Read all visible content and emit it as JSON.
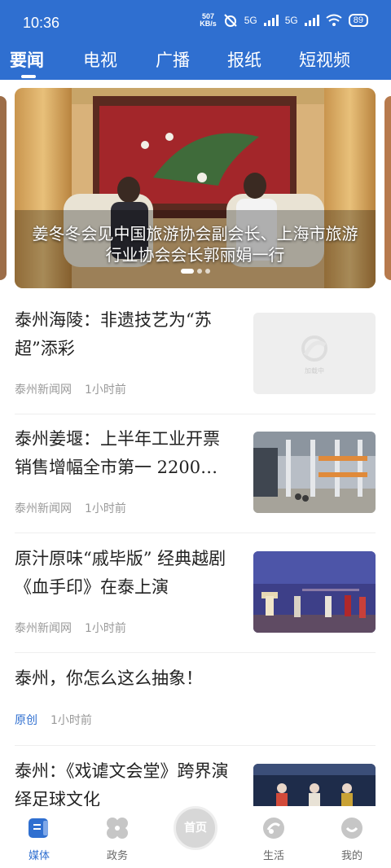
{
  "status_bar": {
    "time": "10:36",
    "speed_value": "507",
    "speed_unit": "KB/s",
    "sim1": "5G",
    "sim2": "5G",
    "battery": "89"
  },
  "tabs": [
    "要闻",
    "电视",
    "广播",
    "报纸",
    "短视频"
  ],
  "active_tab": "要闻",
  "carousel": {
    "caption": "姜冬冬会见中国旅游协会副会长、上海市旅游行业协会会长郭丽娟一行",
    "slide_count": 3,
    "active_index": 0,
    "placeholder_text": "加载中"
  },
  "articles": [
    {
      "title": "泰州海陵：非遗技艺为“苏超”添彩",
      "source": "泰州新闻网",
      "time": "1小时前",
      "thumbnail": "placeholder"
    },
    {
      "title": "泰州姜堰：上半年工业开票销售增幅全市第一 2200…",
      "source": "泰州新闻网",
      "time": "1小时前",
      "thumbnail": "factory"
    },
    {
      "title": "原汁原味“戚毕版” 经典越剧《血手印》在泰上演",
      "source": "泰州新闻网",
      "time": "1小时前",
      "thumbnail": "stage"
    },
    {
      "title": "泰州，你怎么这么抽象！",
      "source": "原创",
      "time": "1小时前",
      "thumbnail": null
    },
    {
      "title": "泰州：《戏谑文会堂》跨界演绎足球文化",
      "source": "",
      "time": "",
      "thumbnail": "opera"
    }
  ],
  "bottom_nav": {
    "items": [
      {
        "label": "媒体",
        "icon": "media-icon",
        "active": true
      },
      {
        "label": "政务",
        "icon": "government-icon",
        "active": false
      },
      {
        "label": "首页",
        "icon": "home-icon",
        "active": false
      },
      {
        "label": "生活",
        "icon": "life-icon",
        "active": false
      },
      {
        "label": "我的",
        "icon": "profile-icon",
        "active": false
      }
    ]
  },
  "colors": {
    "brand": "#2f6fd0",
    "text": "#222222",
    "meta": "#999999"
  }
}
